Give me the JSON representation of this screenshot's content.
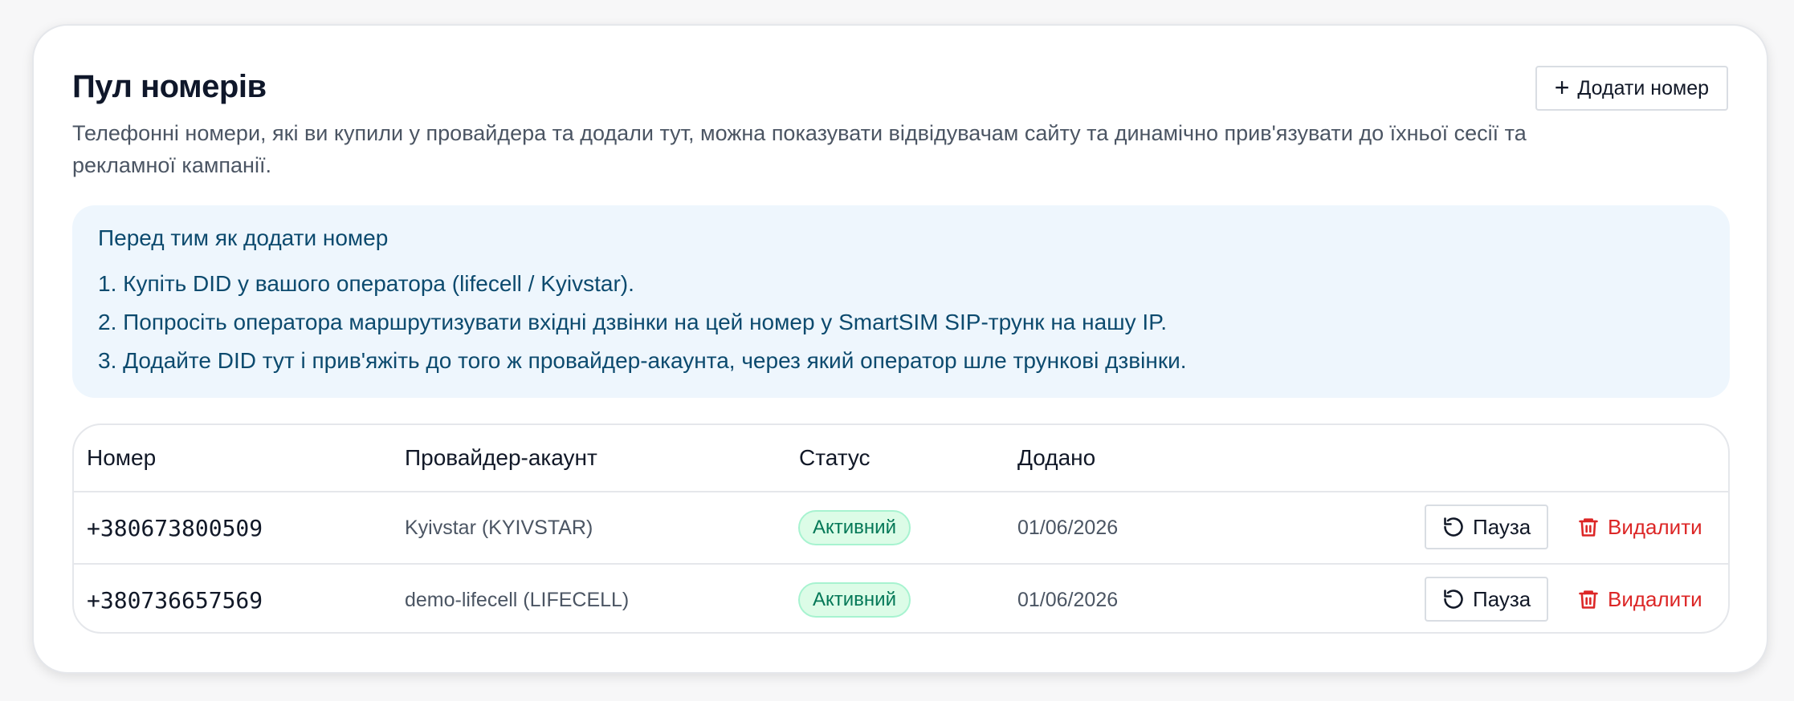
{
  "header": {
    "title": "Пул номерів",
    "description": "Телефонні номери, які ви купили у провайдера та додали тут, можна показувати відвідувачам сайту та динамічно прив'язувати до їхньої сесії та рекламної кампанії.",
    "add_button_label": "Додати номер",
    "add_icon": "plus-icon"
  },
  "info": {
    "title": "Перед тим як додати номер",
    "steps": [
      "1. Купіть DID у вашого оператора (lifecell / Kyivstar).",
      "2. Попросіть оператора маршрутизувати вхідні дзвінки на цей номер у SmartSIM SIP-трунк на нашу IP.",
      "3. Додайте DID тут і прив'яжіть до того ж провайдер-акаунта, через який оператор шле трункові дзвінки."
    ]
  },
  "table": {
    "columns": [
      "Номер",
      "Провайдер-акаунт",
      "Статус",
      "Додано"
    ],
    "rows": [
      {
        "number": "+380673800509",
        "provider": "Kyivstar (KYIVSTAR)",
        "status": "Активний",
        "added": "01/06/2026",
        "pause_label": "Пауза",
        "delete_label": "Видалити"
      },
      {
        "number": "+380736657569",
        "provider": "demo-lifecell (LIFECELL)",
        "status": "Активний",
        "added": "01/06/2026",
        "pause_label": "Пауза",
        "delete_label": "Видалити"
      }
    ]
  },
  "colors": {
    "info_bg": "#eef6fd",
    "info_text": "#0c4a6e",
    "badge_bg": "#dcfce7",
    "badge_text": "#047857",
    "danger": "#dc2626"
  }
}
